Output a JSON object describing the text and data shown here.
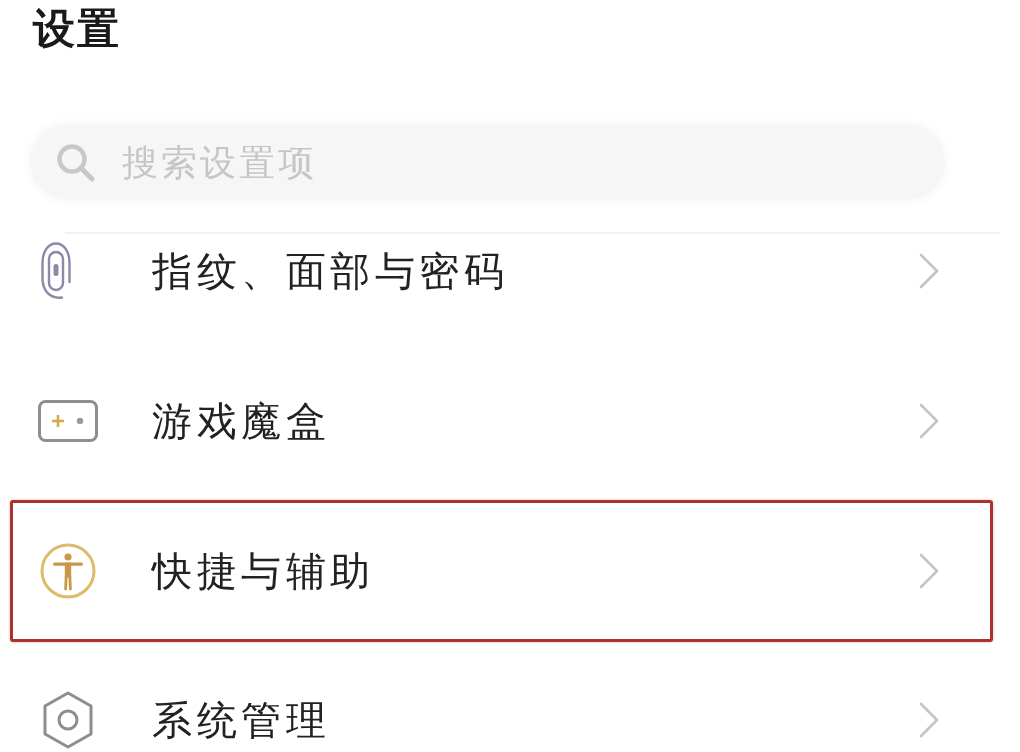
{
  "header": {
    "title": "设置"
  },
  "search": {
    "placeholder": "搜索设置项"
  },
  "items": [
    {
      "label": "指纹、面部与密码",
      "highlighted": false
    },
    {
      "label": "游戏魔盒",
      "highlighted": false
    },
    {
      "label": "快捷与辅助",
      "highlighted": true
    },
    {
      "label": "系统管理",
      "highlighted": false
    }
  ]
}
